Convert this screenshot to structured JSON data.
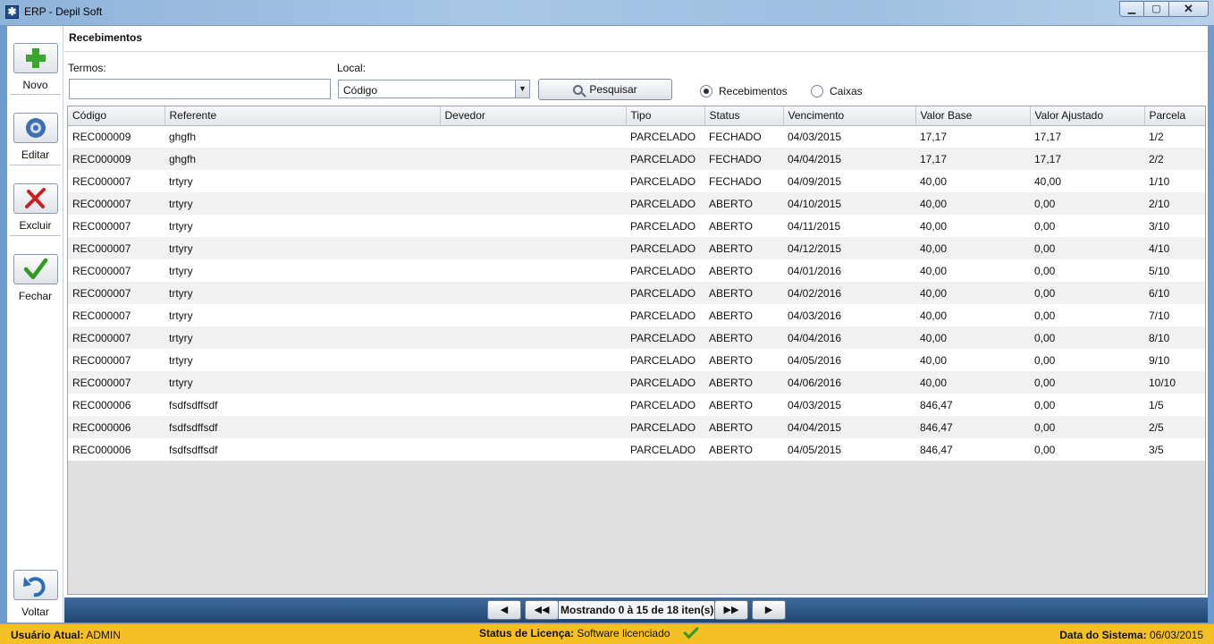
{
  "window": {
    "title": "ERP - Depil Soft"
  },
  "sidebar": {
    "new_label": "Novo",
    "edit_label": "Editar",
    "delete_label": "Excluir",
    "close_label": "Fechar",
    "back_label": "Voltar"
  },
  "page": {
    "title": "Recebimentos"
  },
  "search": {
    "terms_label": "Termos:",
    "terms_value": "",
    "local_label": "Local:",
    "local_selected": "Código",
    "search_button": "Pesquisar",
    "radio_receipts": "Recebimentos",
    "radio_cash": "Caixas",
    "selected_radio": "Recebimentos"
  },
  "table": {
    "columns": [
      "Código",
      "Referente",
      "Devedor",
      "Tipo",
      "Status",
      "Vencimento",
      "Valor Base",
      "Valor Ajustado",
      "Parcela"
    ],
    "rows": [
      [
        "REC000009",
        "ghgfh",
        "",
        "PARCELADO",
        "FECHADO",
        "04/03/2015",
        "17,17",
        "17,17",
        "1/2"
      ],
      [
        "REC000009",
        "ghgfh",
        "",
        "PARCELADO",
        "FECHADO",
        "04/04/2015",
        "17,17",
        "17,17",
        "2/2"
      ],
      [
        "REC000007",
        "trtyry",
        "",
        "PARCELADO",
        "FECHADO",
        "04/09/2015",
        "40,00",
        "40,00",
        "1/10"
      ],
      [
        "REC000007",
        "trtyry",
        "",
        "PARCELADO",
        "ABERTO",
        "04/10/2015",
        "40,00",
        "0,00",
        "2/10"
      ],
      [
        "REC000007",
        "trtyry",
        "",
        "PARCELADO",
        "ABERTO",
        "04/11/2015",
        "40,00",
        "0,00",
        "3/10"
      ],
      [
        "REC000007",
        "trtyry",
        "",
        "PARCELADO",
        "ABERTO",
        "04/12/2015",
        "40,00",
        "0,00",
        "4/10"
      ],
      [
        "REC000007",
        "trtyry",
        "",
        "PARCELADO",
        "ABERTO",
        "04/01/2016",
        "40,00",
        "0,00",
        "5/10"
      ],
      [
        "REC000007",
        "trtyry",
        "",
        "PARCELADO",
        "ABERTO",
        "04/02/2016",
        "40,00",
        "0,00",
        "6/10"
      ],
      [
        "REC000007",
        "trtyry",
        "",
        "PARCELADO",
        "ABERTO",
        "04/03/2016",
        "40,00",
        "0,00",
        "7/10"
      ],
      [
        "REC000007",
        "trtyry",
        "",
        "PARCELADO",
        "ABERTO",
        "04/04/2016",
        "40,00",
        "0,00",
        "8/10"
      ],
      [
        "REC000007",
        "trtyry",
        "",
        "PARCELADO",
        "ABERTO",
        "04/05/2016",
        "40,00",
        "0,00",
        "9/10"
      ],
      [
        "REC000007",
        "trtyry",
        "",
        "PARCELADO",
        "ABERTO",
        "04/06/2016",
        "40,00",
        "0,00",
        "10/10"
      ],
      [
        "REC000006",
        "fsdfsdffsdf",
        "",
        "PARCELADO",
        "ABERTO",
        "04/03/2015",
        "846,47",
        "0,00",
        "1/5"
      ],
      [
        "REC000006",
        "fsdfsdffsdf",
        "",
        "PARCELADO",
        "ABERTO",
        "04/04/2015",
        "846,47",
        "0,00",
        "2/5"
      ],
      [
        "REC000006",
        "fsdfsdffsdf",
        "",
        "PARCELADO",
        "ABERTO",
        "04/05/2015",
        "846,47",
        "0,00",
        "3/5"
      ]
    ]
  },
  "pager": {
    "info": "Mostrando 0 à 15 de 18 iten(s)"
  },
  "status_bar": {
    "user_label": "Usuário Atual:",
    "user_value": "ADMIN",
    "license_label": "Status de Licença:",
    "license_value": "Software licenciado",
    "date_label": "Data do Sistema:",
    "date_value": "06/03/2015"
  },
  "colors": {
    "accent": "#1f4573",
    "status_bar": "#f4c025",
    "ok_green": "#2e9a1f",
    "delete_red": "#cc2020"
  }
}
